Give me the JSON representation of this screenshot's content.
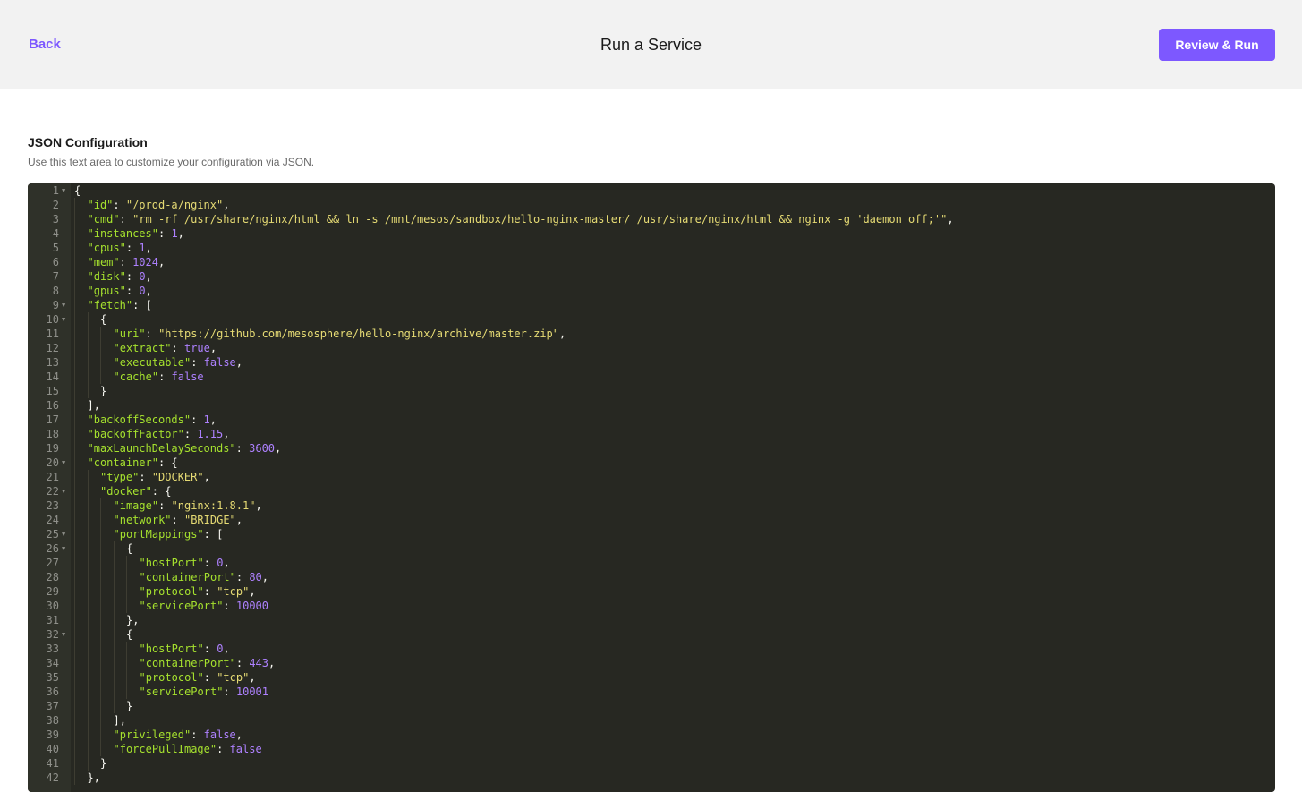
{
  "header": {
    "back_label": "Back",
    "title": "Run a Service",
    "primary_label": "Review & Run"
  },
  "section": {
    "title": "JSON Configuration",
    "help": "Use this text area to customize your configuration via JSON."
  },
  "colors": {
    "accent": "#7d58ff",
    "editor_bg": "#272822",
    "key": "#a6e22e",
    "string": "#e6db74",
    "number": "#ae81ff"
  },
  "editor": {
    "lines": [
      {
        "num": "1",
        "fold": true,
        "indent": 0,
        "tokens": [
          [
            "p",
            "{"
          ]
        ]
      },
      {
        "num": "2",
        "fold": false,
        "indent": 1,
        "tokens": [
          [
            "k",
            "\"id\""
          ],
          [
            "p",
            ": "
          ],
          [
            "s",
            "\"/prod-a/nginx\""
          ],
          [
            "p",
            ","
          ]
        ]
      },
      {
        "num": "3",
        "fold": false,
        "indent": 1,
        "tokens": [
          [
            "k",
            "\"cmd\""
          ],
          [
            "p",
            ": "
          ],
          [
            "s",
            "\"rm -rf /usr/share/nginx/html && ln -s /mnt/mesos/sandbox/hello-nginx-master/ /usr/share/nginx/html && nginx -g 'daemon off;'\""
          ],
          [
            "p",
            ","
          ]
        ]
      },
      {
        "num": "4",
        "fold": false,
        "indent": 1,
        "tokens": [
          [
            "k",
            "\"instances\""
          ],
          [
            "p",
            ": "
          ],
          [
            "n",
            "1"
          ],
          [
            "p",
            ","
          ]
        ]
      },
      {
        "num": "5",
        "fold": false,
        "indent": 1,
        "tokens": [
          [
            "k",
            "\"cpus\""
          ],
          [
            "p",
            ": "
          ],
          [
            "n",
            "1"
          ],
          [
            "p",
            ","
          ]
        ]
      },
      {
        "num": "6",
        "fold": false,
        "indent": 1,
        "tokens": [
          [
            "k",
            "\"mem\""
          ],
          [
            "p",
            ": "
          ],
          [
            "n",
            "1024"
          ],
          [
            "p",
            ","
          ]
        ]
      },
      {
        "num": "7",
        "fold": false,
        "indent": 1,
        "tokens": [
          [
            "k",
            "\"disk\""
          ],
          [
            "p",
            ": "
          ],
          [
            "n",
            "0"
          ],
          [
            "p",
            ","
          ]
        ]
      },
      {
        "num": "8",
        "fold": false,
        "indent": 1,
        "tokens": [
          [
            "k",
            "\"gpus\""
          ],
          [
            "p",
            ": "
          ],
          [
            "n",
            "0"
          ],
          [
            "p",
            ","
          ]
        ]
      },
      {
        "num": "9",
        "fold": true,
        "indent": 1,
        "tokens": [
          [
            "k",
            "\"fetch\""
          ],
          [
            "p",
            ": ["
          ]
        ]
      },
      {
        "num": "10",
        "fold": true,
        "indent": 2,
        "tokens": [
          [
            "p",
            "{"
          ]
        ]
      },
      {
        "num": "11",
        "fold": false,
        "indent": 3,
        "tokens": [
          [
            "k",
            "\"uri\""
          ],
          [
            "p",
            ": "
          ],
          [
            "s",
            "\"https://github.com/mesosphere/hello-nginx/archive/master.zip\""
          ],
          [
            "p",
            ","
          ]
        ]
      },
      {
        "num": "12",
        "fold": false,
        "indent": 3,
        "tokens": [
          [
            "k",
            "\"extract\""
          ],
          [
            "p",
            ": "
          ],
          [
            "b",
            "true"
          ],
          [
            "p",
            ","
          ]
        ]
      },
      {
        "num": "13",
        "fold": false,
        "indent": 3,
        "tokens": [
          [
            "k",
            "\"executable\""
          ],
          [
            "p",
            ": "
          ],
          [
            "b",
            "false"
          ],
          [
            "p",
            ","
          ]
        ]
      },
      {
        "num": "14",
        "fold": false,
        "indent": 3,
        "tokens": [
          [
            "k",
            "\"cache\""
          ],
          [
            "p",
            ": "
          ],
          [
            "b",
            "false"
          ]
        ]
      },
      {
        "num": "15",
        "fold": false,
        "indent": 2,
        "tokens": [
          [
            "p",
            "}"
          ]
        ]
      },
      {
        "num": "16",
        "fold": false,
        "indent": 1,
        "tokens": [
          [
            "p",
            "],"
          ]
        ]
      },
      {
        "num": "17",
        "fold": false,
        "indent": 1,
        "tokens": [
          [
            "k",
            "\"backoffSeconds\""
          ],
          [
            "p",
            ": "
          ],
          [
            "n",
            "1"
          ],
          [
            "p",
            ","
          ]
        ]
      },
      {
        "num": "18",
        "fold": false,
        "indent": 1,
        "tokens": [
          [
            "k",
            "\"backoffFactor\""
          ],
          [
            "p",
            ": "
          ],
          [
            "n",
            "1.15"
          ],
          [
            "p",
            ","
          ]
        ]
      },
      {
        "num": "19",
        "fold": false,
        "indent": 1,
        "tokens": [
          [
            "k",
            "\"maxLaunchDelaySeconds\""
          ],
          [
            "p",
            ": "
          ],
          [
            "n",
            "3600"
          ],
          [
            "p",
            ","
          ]
        ]
      },
      {
        "num": "20",
        "fold": true,
        "indent": 1,
        "tokens": [
          [
            "k",
            "\"container\""
          ],
          [
            "p",
            ": {"
          ]
        ]
      },
      {
        "num": "21",
        "fold": false,
        "indent": 2,
        "tokens": [
          [
            "k",
            "\"type\""
          ],
          [
            "p",
            ": "
          ],
          [
            "s",
            "\"DOCKER\""
          ],
          [
            "p",
            ","
          ]
        ]
      },
      {
        "num": "22",
        "fold": true,
        "indent": 2,
        "tokens": [
          [
            "k",
            "\"docker\""
          ],
          [
            "p",
            ": {"
          ]
        ]
      },
      {
        "num": "23",
        "fold": false,
        "indent": 3,
        "tokens": [
          [
            "k",
            "\"image\""
          ],
          [
            "p",
            ": "
          ],
          [
            "s",
            "\"nginx:1.8.1\""
          ],
          [
            "p",
            ","
          ]
        ]
      },
      {
        "num": "24",
        "fold": false,
        "indent": 3,
        "tokens": [
          [
            "k",
            "\"network\""
          ],
          [
            "p",
            ": "
          ],
          [
            "s",
            "\"BRIDGE\""
          ],
          [
            "p",
            ","
          ]
        ]
      },
      {
        "num": "25",
        "fold": true,
        "indent": 3,
        "tokens": [
          [
            "k",
            "\"portMappings\""
          ],
          [
            "p",
            ": ["
          ]
        ]
      },
      {
        "num": "26",
        "fold": true,
        "indent": 4,
        "tokens": [
          [
            "p",
            "{"
          ]
        ]
      },
      {
        "num": "27",
        "fold": false,
        "indent": 5,
        "tokens": [
          [
            "k",
            "\"hostPort\""
          ],
          [
            "p",
            ": "
          ],
          [
            "n",
            "0"
          ],
          [
            "p",
            ","
          ]
        ]
      },
      {
        "num": "28",
        "fold": false,
        "indent": 5,
        "tokens": [
          [
            "k",
            "\"containerPort\""
          ],
          [
            "p",
            ": "
          ],
          [
            "n",
            "80"
          ],
          [
            "p",
            ","
          ]
        ]
      },
      {
        "num": "29",
        "fold": false,
        "indent": 5,
        "tokens": [
          [
            "k",
            "\"protocol\""
          ],
          [
            "p",
            ": "
          ],
          [
            "s",
            "\"tcp\""
          ],
          [
            "p",
            ","
          ]
        ]
      },
      {
        "num": "30",
        "fold": false,
        "indent": 5,
        "tokens": [
          [
            "k",
            "\"servicePort\""
          ],
          [
            "p",
            ": "
          ],
          [
            "n",
            "10000"
          ]
        ]
      },
      {
        "num": "31",
        "fold": false,
        "indent": 4,
        "tokens": [
          [
            "p",
            "},"
          ]
        ]
      },
      {
        "num": "32",
        "fold": true,
        "indent": 4,
        "tokens": [
          [
            "p",
            "{"
          ]
        ]
      },
      {
        "num": "33",
        "fold": false,
        "indent": 5,
        "tokens": [
          [
            "k",
            "\"hostPort\""
          ],
          [
            "p",
            ": "
          ],
          [
            "n",
            "0"
          ],
          [
            "p",
            ","
          ]
        ]
      },
      {
        "num": "34",
        "fold": false,
        "indent": 5,
        "tokens": [
          [
            "k",
            "\"containerPort\""
          ],
          [
            "p",
            ": "
          ],
          [
            "n",
            "443"
          ],
          [
            "p",
            ","
          ]
        ]
      },
      {
        "num": "35",
        "fold": false,
        "indent": 5,
        "tokens": [
          [
            "k",
            "\"protocol\""
          ],
          [
            "p",
            ": "
          ],
          [
            "s",
            "\"tcp\""
          ],
          [
            "p",
            ","
          ]
        ]
      },
      {
        "num": "36",
        "fold": false,
        "indent": 5,
        "tokens": [
          [
            "k",
            "\"servicePort\""
          ],
          [
            "p",
            ": "
          ],
          [
            "n",
            "10001"
          ]
        ]
      },
      {
        "num": "37",
        "fold": false,
        "indent": 4,
        "tokens": [
          [
            "p",
            "}"
          ]
        ]
      },
      {
        "num": "38",
        "fold": false,
        "indent": 3,
        "tokens": [
          [
            "p",
            "],"
          ]
        ]
      },
      {
        "num": "39",
        "fold": false,
        "indent": 3,
        "tokens": [
          [
            "k",
            "\"privileged\""
          ],
          [
            "p",
            ": "
          ],
          [
            "b",
            "false"
          ],
          [
            "p",
            ","
          ]
        ]
      },
      {
        "num": "40",
        "fold": false,
        "indent": 3,
        "tokens": [
          [
            "k",
            "\"forcePullImage\""
          ],
          [
            "p",
            ": "
          ],
          [
            "b",
            "false"
          ]
        ]
      },
      {
        "num": "41",
        "fold": false,
        "indent": 2,
        "tokens": [
          [
            "p",
            "}"
          ]
        ]
      },
      {
        "num": "42",
        "fold": false,
        "indent": 1,
        "tokens": [
          [
            "p",
            "},"
          ]
        ]
      }
    ]
  }
}
